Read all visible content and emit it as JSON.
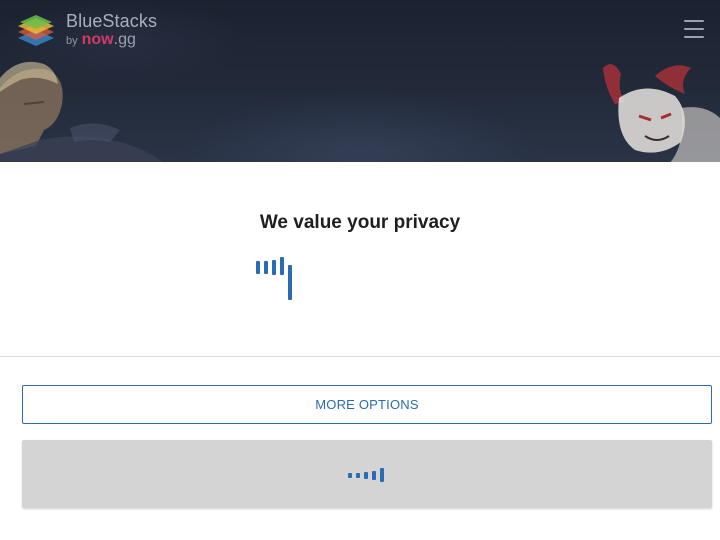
{
  "header": {
    "brand": "BlueStacks",
    "sub_by": "by",
    "sub_now": "now",
    "sub_gg": ".gg",
    "logo_icon": "bluestacks-logo-icon",
    "menu_icon": "hamburger-menu-icon"
  },
  "privacy": {
    "title": "We value your privacy",
    "loading_icon": "loading-spinner-icon"
  },
  "buttons": {
    "more_options": "MORE OPTIONS",
    "accept_loading_icon": "loading-spinner-icon"
  },
  "colors": {
    "accent": "#2a6cb3",
    "header_bg": "#1c2130",
    "brand_now": "#d33a63",
    "button_disabled": "#d4d4d4"
  }
}
